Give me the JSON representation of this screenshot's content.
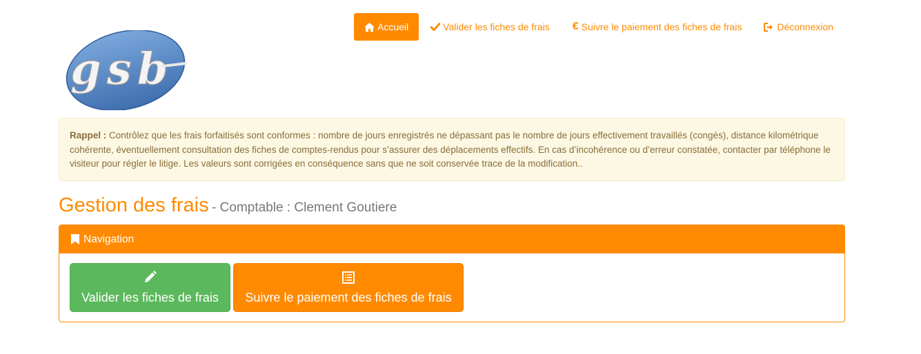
{
  "logo": {
    "text": "gsb"
  },
  "nav": {
    "items": [
      {
        "label": "Accueil",
        "icon": "home-icon"
      },
      {
        "label": "Valider les fiches de frais",
        "icon": "check-icon"
      },
      {
        "label": "Suivre le paiement des fiches de frais",
        "icon": "euro-icon"
      },
      {
        "label": "Déconnexion",
        "icon": "logout-icon"
      }
    ]
  },
  "alert": {
    "prefix": "Rappel :",
    "text": "Contrôlez que les frais forfaitisés sont conformes : nombre de jours enregistrés ne dépassant pas le nombre de jours effectivement travaillés (congés), distance kilométrique cohérente, éventuellement consultation des fiches de comptes-rendus pour s’assurer des déplacements effectifs. En cas d’incohérence ou d’erreur constatée, contacter par téléphone le visiteur pour régler le litige. Les valeurs sont corrigées en conséquence sans que ne soit conservée trace de la modification.."
  },
  "heading": {
    "title": "Gestion des frais",
    "subtitle": "- Comptable : Clement Goutiere"
  },
  "panel": {
    "title": "Navigation",
    "icon": "bookmark-icon",
    "buttons": [
      {
        "label": "Valider les fiches de frais",
        "icon": "pencil-icon"
      },
      {
        "label": "Suivre le paiement des fiches de frais",
        "icon": "list-icon"
      }
    ]
  },
  "colors": {
    "accent": "#ff8a00",
    "success": "#5cb85c",
    "alert_bg": "#fcf8e3",
    "alert_text": "#8a6d3b"
  }
}
